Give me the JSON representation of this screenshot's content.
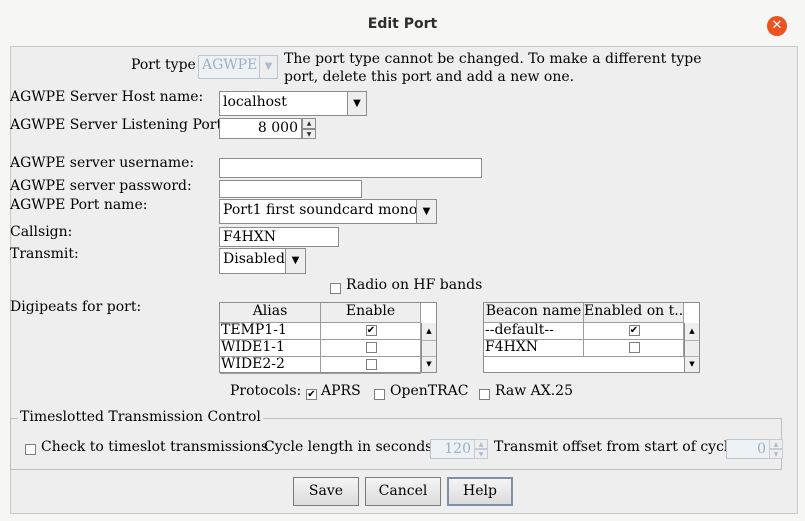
{
  "window": {
    "title": "Edit Port",
    "close_icon": "✕"
  },
  "port_type": {
    "label": "Port type",
    "value": "AGWPE",
    "note_line1": "The port type cannot be changed. To make a different type",
    "note_line2": "port, delete this port and add a new one."
  },
  "host": {
    "label": "AGWPE Server Host name:",
    "value": "localhost"
  },
  "listen_port": {
    "label": "AGWPE Server Listening Port#:",
    "value": "8 000"
  },
  "username": {
    "label": "AGWPE server username:",
    "value": ""
  },
  "password": {
    "label": "AGWPE server password:",
    "value": ""
  },
  "port_name": {
    "label": "AGWPE Port name:",
    "value": "Port1 first soundcard mono"
  },
  "callsign": {
    "label": "Callsign:",
    "value": "F4HXN"
  },
  "transmit": {
    "label": "Transmit:",
    "value": "Disabled"
  },
  "radio_hf": {
    "label": "Radio on HF bands",
    "checked": false
  },
  "digipeats": {
    "label": "Digipeats for port:",
    "columns": [
      "Alias",
      "Enable"
    ],
    "rows": [
      {
        "alias": "TEMP1-1",
        "enabled": true
      },
      {
        "alias": "WIDE1-1",
        "enabled": false
      },
      {
        "alias": "WIDE2-2",
        "enabled": false
      }
    ]
  },
  "beacons": {
    "columns": [
      "Beacon name",
      "Enabled on t..."
    ],
    "rows": [
      {
        "name": "--default--",
        "enabled": true
      },
      {
        "name": "F4HXN",
        "enabled": false
      }
    ]
  },
  "protocols": {
    "label": "Protocols:",
    "items": [
      {
        "label": "APRS",
        "checked": true
      },
      {
        "label": "OpenTRAC",
        "checked": false
      },
      {
        "label": "Raw AX.25",
        "checked": false
      }
    ]
  },
  "timeslot": {
    "title": "Timeslotted Transmission Control",
    "check_label": "Check to timeslot transmissions",
    "checked": false,
    "cycle_label": "Cycle length in seconds:",
    "cycle_value": "120",
    "offset_label": "Transmit offset from start of cycle:",
    "offset_value": "0"
  },
  "buttons": {
    "save": "Save",
    "cancel": "Cancel",
    "help": "Help"
  },
  "glyphs": {
    "combo_arrow": "▼",
    "up": "▲",
    "down": "▼",
    "check": "✔"
  }
}
